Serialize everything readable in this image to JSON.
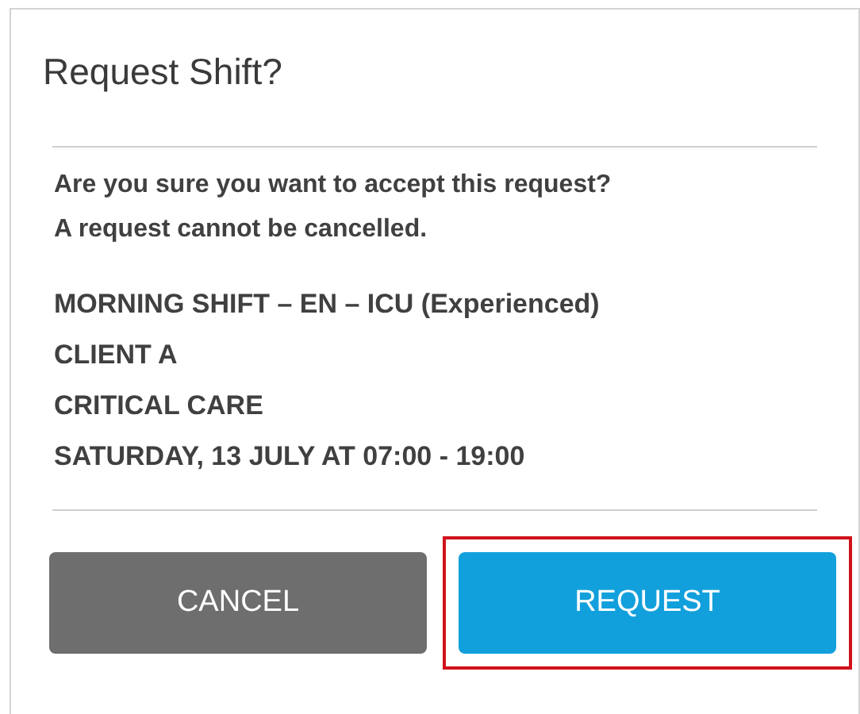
{
  "dialog": {
    "title": "Request Shift?",
    "message": [
      "Are you sure you want to accept this request?",
      "A request cannot be cancelled."
    ],
    "details": [
      "MORNING SHIFT – EN – ICU (Experienced)",
      "CLIENT A",
      "CRITICAL CARE",
      "SATURDAY, 13 JULY AT 07:00 - 19:00"
    ],
    "buttons": [
      {
        "label": "CANCEL",
        "kind": "secondary",
        "highlighted": false
      },
      {
        "label": "REQUEST",
        "kind": "primary",
        "highlighted": true
      }
    ]
  }
}
